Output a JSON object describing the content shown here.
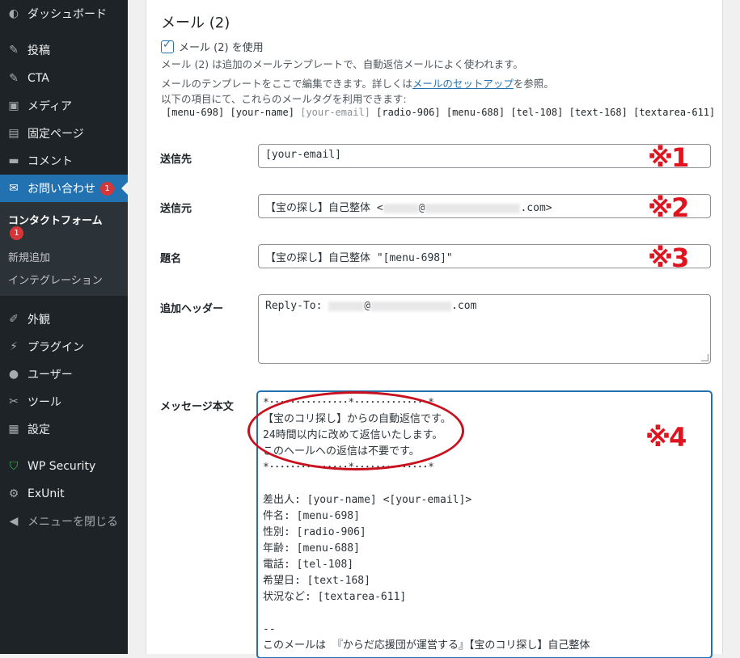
{
  "sidebar": {
    "items": [
      {
        "label": "ダッシュボード",
        "icon": "dashboard-icon",
        "glyph": "◐"
      },
      {
        "label": "投稿",
        "icon": "pushpin-icon",
        "glyph": "✎"
      },
      {
        "label": "CTA",
        "icon": "pushpin-icon",
        "glyph": "✎"
      },
      {
        "label": "メディア",
        "icon": "media-icon",
        "glyph": "▣"
      },
      {
        "label": "固定ページ",
        "icon": "page-icon",
        "glyph": "▤"
      },
      {
        "label": "コメント",
        "icon": "comment-icon",
        "glyph": "▬"
      },
      {
        "label": "お問い合わせ",
        "icon": "mail-icon",
        "glyph": "✉",
        "badge": "1"
      },
      {
        "label": "外観",
        "icon": "appearance-icon",
        "glyph": "✐"
      },
      {
        "label": "プラグイン",
        "icon": "plugin-icon",
        "glyph": "⚡"
      },
      {
        "label": "ユーザー",
        "icon": "user-icon",
        "glyph": "●"
      },
      {
        "label": "ツール",
        "icon": "wrench-icon",
        "glyph": "✂"
      },
      {
        "label": "設定",
        "icon": "settings-icon",
        "glyph": "▦"
      },
      {
        "label": "WP Security",
        "icon": "shield-icon",
        "glyph": "⛉"
      },
      {
        "label": "ExUnit",
        "icon": "gear-icon",
        "glyph": "⚙"
      },
      {
        "label": "メニューを閉じる",
        "icon": "collapse-icon",
        "glyph": "◀"
      }
    ],
    "submenu": [
      {
        "label": "コンタクトフォーム",
        "badge": "1"
      },
      {
        "label": "新規追加"
      },
      {
        "label": "インテグレーション"
      }
    ]
  },
  "mail2": {
    "title": "メール (2)",
    "use_label": "メール (2) を使用",
    "desc1": "メール (2) は追加のメールテンプレートで、自動返信メールによく使われます。",
    "desc2_pre": "メールのテンプレートをここで編集できます。詳しくは",
    "desc2_link": "メールのセットアップ",
    "desc2_post": "を参照。",
    "desc3": "以下の項目にて、これらのメールタグを利用できます:",
    "tags": [
      "[menu-698]",
      "[your-name]",
      "[your-email]",
      "[radio-906]",
      "[menu-688]",
      "[tel-108]",
      "[text-168]",
      "[textarea-611]"
    ],
    "to_label": "送信先",
    "to_value": "[your-email]",
    "from_label": "送信元",
    "from_prefix": "【宝の探し】自己整体 <",
    "from_at": "@",
    "from_suffix": ".com>",
    "subject_label": "題名",
    "subject_value": "【宝の探し】自己整体 \"[menu-698]\"",
    "headers_label": "追加ヘッダー",
    "headers_prefix": "Reply-To: ",
    "headers_at": "@",
    "headers_suffix": ".com",
    "body_label": "メッセージ本文",
    "body_text": "*･･･････････････*･･････････････*\n【宝のコリ探し】からの自動返信です。\n24時間以内に改めて返信いたします。\nこのヘールへの返信は不要です。\n*･･･････････････*･･････････････*\n\n差出人: [your-name] <[your-email]>\n件名: [menu-698]\n性別: [radio-906]\n年齢: [menu-688]\n電話: [tel-108]\n希望日: [text-168]\n状況など: [textarea-611]\n\n--\nこのメールは 『からだ応援団が運営する』【宝のコリ探し】自己整体"
  },
  "annotations": [
    "※1",
    "※2",
    "※3",
    "※4"
  ],
  "colors": {
    "accent": "#2271b1",
    "annotation_red": "#e0141e",
    "sidebar_bg": "#1d2327"
  }
}
